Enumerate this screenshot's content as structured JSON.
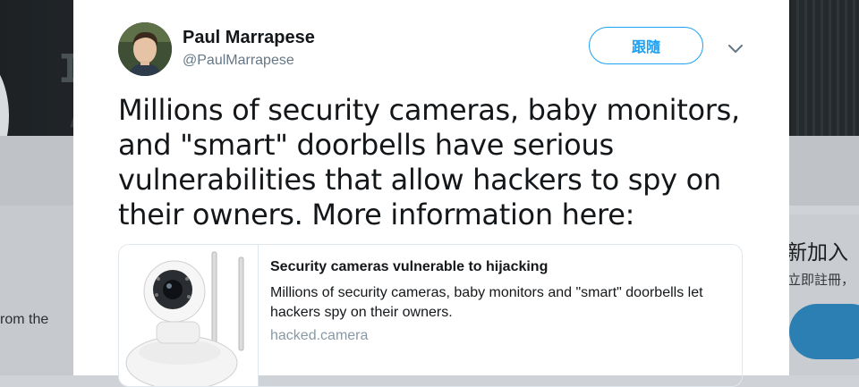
{
  "background": {
    "left_snippet": "rom the",
    "right_title": "新加入",
    "right_subtitle": "立即註冊，"
  },
  "tweet": {
    "author_name": "Paul Marrapese",
    "author_handle": "@PaulMarrapese",
    "follow_label": "跟隨",
    "text": "Millions of security cameras, baby monitors, and \"smart\" doorbells have serious vulnerabilities that allow hackers to spy on their owners. More information here:"
  },
  "link_card": {
    "title": "Security cameras vulnerable to hijacking",
    "description": "Millions of security cameras, baby monitors and \"smart\" doorbells let hackers spy on their owners.",
    "domain": "hacked.camera"
  },
  "colors": {
    "accent": "#1da1f2",
    "text": "#14171a",
    "secondary": "#657786"
  },
  "icons": [
    "chevron-down-icon",
    "avatar-photo",
    "camera-thumbnail"
  ]
}
